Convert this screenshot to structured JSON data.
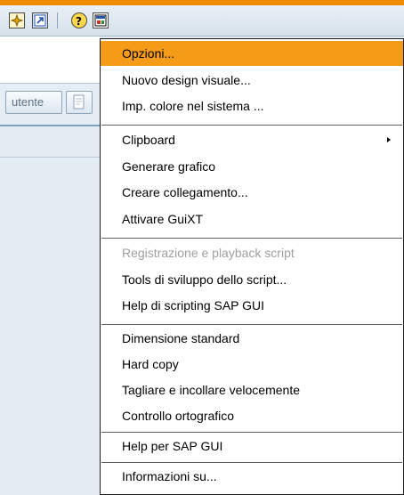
{
  "toolbar": {
    "icons": [
      "sap-tool-icon",
      "shortcut-icon",
      "help-icon",
      "layout-menu-icon"
    ]
  },
  "background": {
    "utente_label": "utente"
  },
  "menu": {
    "items": [
      {
        "label": "Opzioni...",
        "state": "selected"
      },
      {
        "label": "Nuovo design visuale...",
        "state": "enabled"
      },
      {
        "label": "Imp. colore nel sistema ...",
        "state": "enabled"
      },
      {
        "label": "Clipboard",
        "state": "enabled",
        "submenu": true
      },
      {
        "label": "Generare grafico",
        "state": "enabled"
      },
      {
        "label": "Creare collegamento...",
        "state": "enabled"
      },
      {
        "label": "Attivare GuiXT",
        "state": "enabled"
      },
      {
        "label": "Registrazione e playback script",
        "state": "disabled"
      },
      {
        "label": "Tools di sviluppo dello script...",
        "state": "enabled"
      },
      {
        "label": "Help di scripting SAP GUI",
        "state": "enabled"
      },
      {
        "label": "Dimensione standard",
        "state": "enabled"
      },
      {
        "label": "Hard copy",
        "state": "enabled"
      },
      {
        "label": "Tagliare e incollare velocemente",
        "state": "enabled"
      },
      {
        "label": "Controllo ortografico",
        "state": "enabled"
      },
      {
        "label": "Help per SAP GUI",
        "state": "enabled"
      },
      {
        "label": "Informazioni su...",
        "state": "enabled"
      }
    ]
  },
  "colors": {
    "accent_orange": "#f08c00",
    "selection": "#f49b18",
    "disabled_text": "#a0a0a0"
  }
}
